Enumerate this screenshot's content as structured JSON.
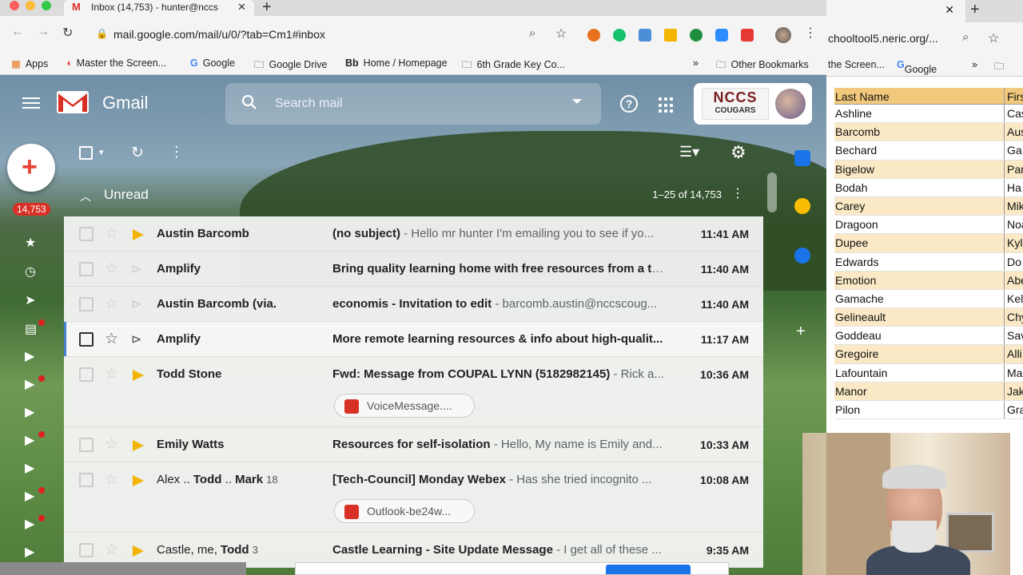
{
  "browser": {
    "tab_title": "Inbox (14,753) - hunter@nccs",
    "url": "mail.google.com/mail/u/0/?tab=Cm1#inbox",
    "bookmarks": [
      "Apps",
      "Master the Screen...",
      "Google",
      "Google Drive",
      "Home / Homepage",
      "6th Grade Key Co...",
      "Other Bookmarks"
    ],
    "bookmarks_overflow": "»"
  },
  "gmail": {
    "brand": "Gmail",
    "search_placeholder": "Search mail",
    "school_logo": {
      "line1": "NCCS",
      "line2": "COUGARS"
    },
    "unread_badge": "14,753",
    "section_label": "Unread",
    "page_range": "1–25 of 14,753",
    "emails": [
      {
        "sender": "Austin Barcomb",
        "subject": "(no subject)",
        "preview": " - Hello mr hunter I'm emailing you to see if yo...",
        "time": "11:41 AM",
        "important": true
      },
      {
        "sender": "Amplify",
        "subject": "Bring quality learning home with free resources from a to...",
        "preview": "",
        "time": "11:40 AM",
        "important": false
      },
      {
        "sender": "Austin Barcomb (via.",
        "subject": "economis - Invitation to edit",
        "preview": " - barcomb.austin@nccscoug...",
        "time": "11:40 AM",
        "important": false
      },
      {
        "sender": "Amplify",
        "subject": "More remote learning resources & info about high-qualit...",
        "preview": "",
        "time": "11:17 AM",
        "important": false
      },
      {
        "sender": "Todd Stone",
        "subject": "Fwd: Message from COUPAL LYNN (5182982145)",
        "preview": " - Rick a...",
        "time": "10:36 AM",
        "important": true,
        "attachment": "VoiceMessage...."
      },
      {
        "sender": "Emily Watts",
        "subject": "Resources for self-isolation",
        "preview": " - Hello, My name is Emily and...",
        "time": "10:33 AM",
        "important": true
      },
      {
        "sender_parts": [
          "Alex .. ",
          "Todd",
          " .. ",
          "Mark"
        ],
        "count": "18",
        "subject": "[Tech-Council] Monday Webex",
        "preview": " - Has she tried incognito ...",
        "time": "10:08 AM",
        "important": true,
        "attachment": "Outlook-be24w..."
      },
      {
        "sender_parts": [
          "Castle, me, ",
          "Todd"
        ],
        "count": "3",
        "subject": "Castle Learning - Site Update Message",
        "preview": " - I get all of these ...",
        "time": "9:35 AM",
        "important": true
      }
    ]
  },
  "second_window": {
    "url": "chooltool5.neric.org/...",
    "bookmarks": [
      "the Screen...",
      "Google",
      "»"
    ],
    "table": {
      "headers": [
        "Last Name",
        "Firs"
      ],
      "rows": [
        [
          "Ashline",
          "Cas"
        ],
        [
          "Barcomb",
          "Aus"
        ],
        [
          "Bechard",
          "Ga"
        ],
        [
          "Bigelow",
          "Par"
        ],
        [
          "Bodah",
          "Ha"
        ],
        [
          "Carey",
          "Mik"
        ],
        [
          "Dragoon",
          "Noa"
        ],
        [
          "Dupee",
          "Kyl"
        ],
        [
          "Edwards",
          "Do"
        ],
        [
          "Emotion",
          "Abe"
        ],
        [
          "Gamache",
          "Kel"
        ],
        [
          "Gelineault",
          "Chy"
        ],
        [
          "Goddeau",
          "Sav"
        ],
        [
          "Gregoire",
          "Alli"
        ],
        [
          "Lafountain",
          "Ma"
        ],
        [
          "Manor",
          "Jak"
        ],
        [
          "Pilon",
          "Gra"
        ]
      ]
    }
  },
  "colors": {
    "gmail_red": "#d93025",
    "important_yellow": "#f2b400",
    "sheet_header": "#f2c97c",
    "sheet_alt": "#fbe9c6",
    "accent_blue": "#1a73e8"
  }
}
